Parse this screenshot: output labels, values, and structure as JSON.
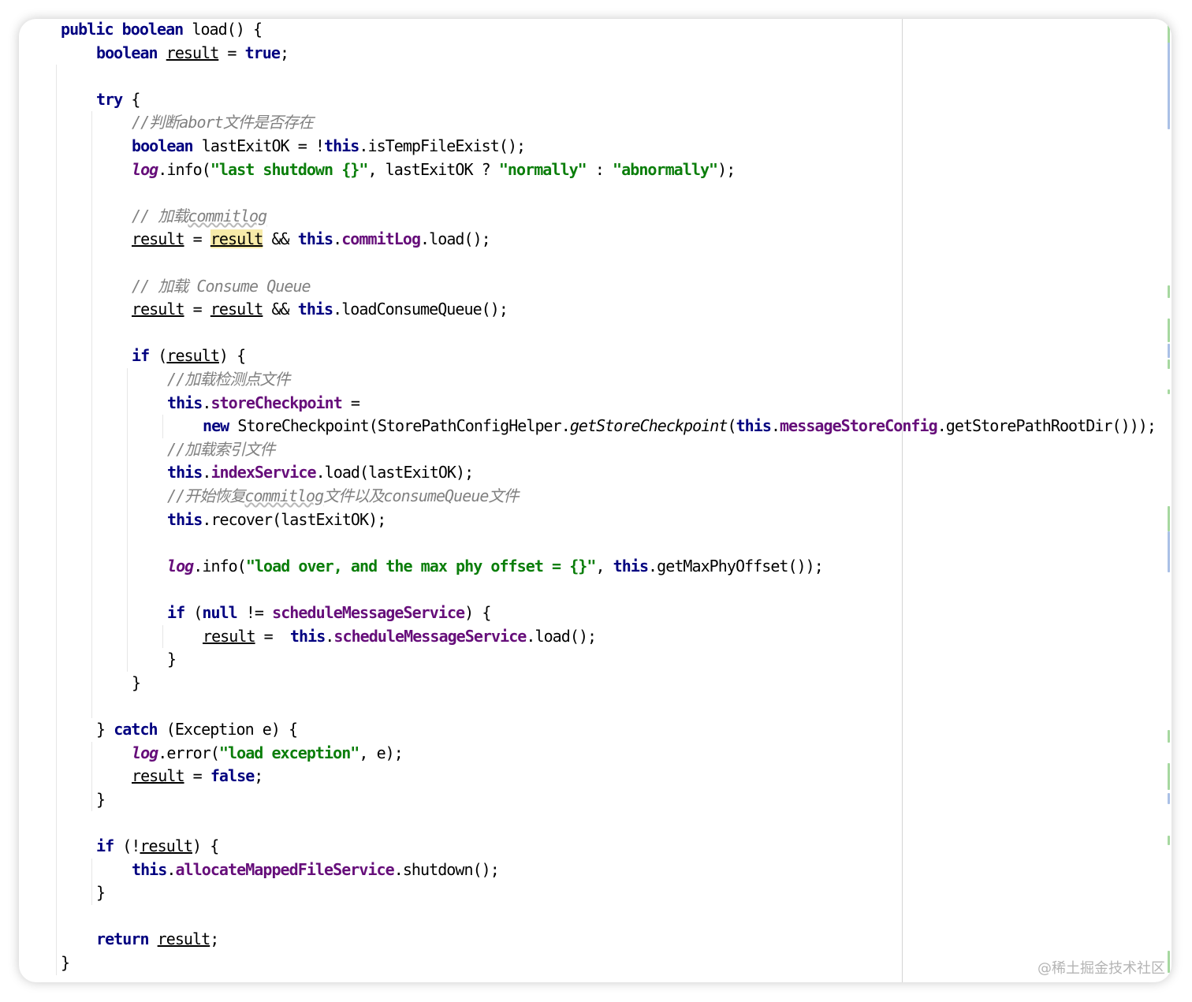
{
  "editor": {
    "language": "Java",
    "lines": [
      [
        [
          "kw",
          "public"
        ],
        [
          "t",
          " "
        ],
        [
          "kw",
          "boolean"
        ],
        [
          "t",
          " load() {"
        ]
      ],
      [
        [
          "kw",
          "boolean"
        ],
        [
          "t",
          " "
        ],
        [
          "var",
          "result"
        ],
        [
          "t",
          " = "
        ],
        [
          "kw",
          "true"
        ],
        [
          "t",
          ";"
        ]
      ],
      [],
      [
        [
          "kw",
          "try"
        ],
        [
          "t",
          " {"
        ]
      ],
      [
        [
          "cm",
          "//判断abort文件是否存在"
        ]
      ],
      [
        [
          "kw",
          "boolean"
        ],
        [
          "t",
          " lastExitOK = !"
        ],
        [
          "kw",
          "this"
        ],
        [
          "t",
          ".isTempFileExist();"
        ]
      ],
      [
        [
          "st",
          "log"
        ],
        [
          "t",
          ".info("
        ],
        [
          "str",
          "\"last shutdown {}\""
        ],
        [
          "t",
          ", lastExitOK ? "
        ],
        [
          "str",
          "\"normally\""
        ],
        [
          "t",
          " : "
        ],
        [
          "str",
          "\"abnormally\""
        ],
        [
          "t",
          ");"
        ]
      ],
      [],
      [
        [
          "cm",
          "// 加载"
        ],
        [
          "cmsq",
          "commitlog"
        ]
      ],
      [
        [
          "var",
          "result"
        ],
        [
          "t",
          " = "
        ],
        [
          "varhl",
          "result"
        ],
        [
          "t",
          " && "
        ],
        [
          "kw",
          "this"
        ],
        [
          "t",
          "."
        ],
        [
          "fld",
          "commitLog"
        ],
        [
          "t",
          ".load();"
        ]
      ],
      [],
      [
        [
          "cm",
          "// 加载 Consume Queue"
        ]
      ],
      [
        [
          "var",
          "result"
        ],
        [
          "t",
          " = "
        ],
        [
          "var",
          "result"
        ],
        [
          "t",
          " && "
        ],
        [
          "kw",
          "this"
        ],
        [
          "t",
          ".loadConsumeQueue();"
        ]
      ],
      [],
      [
        [
          "kw",
          "if"
        ],
        [
          "t",
          " ("
        ],
        [
          "var",
          "result"
        ],
        [
          "t",
          ") {"
        ]
      ],
      [
        [
          "cm",
          "//加载检测点文件"
        ]
      ],
      [
        [
          "kw",
          "this"
        ],
        [
          "t",
          "."
        ],
        [
          "fld",
          "storeCheckpoint"
        ],
        [
          "t",
          " ="
        ]
      ],
      [
        [
          "kw",
          "new"
        ],
        [
          "t",
          " StoreCheckpoint(StorePathConfigHelper."
        ],
        [
          "sm",
          "getStoreCheckpoint"
        ],
        [
          "t",
          "("
        ],
        [
          "kw",
          "this"
        ],
        [
          "t",
          "."
        ],
        [
          "fld",
          "messageStoreConfig"
        ],
        [
          "t",
          ".getStorePathRootDir()));"
        ]
      ],
      [
        [
          "cm",
          "//加载索引文件"
        ]
      ],
      [
        [
          "kw",
          "this"
        ],
        [
          "t",
          "."
        ],
        [
          "fld",
          "indexService"
        ],
        [
          "t",
          ".load(lastExitOK);"
        ]
      ],
      [
        [
          "cm",
          "//开始恢复"
        ],
        [
          "cmsq",
          "commitlog"
        ],
        [
          "cm",
          "文件以及consumeQueue文件"
        ]
      ],
      [
        [
          "kw",
          "this"
        ],
        [
          "t",
          ".recover(lastExitOK);"
        ]
      ],
      [],
      [
        [
          "st",
          "log"
        ],
        [
          "t",
          ".info("
        ],
        [
          "str",
          "\"load over, and the max phy offset = {}\""
        ],
        [
          "t",
          ", "
        ],
        [
          "kw",
          "this"
        ],
        [
          "t",
          ".getMaxPhyOffset());"
        ]
      ],
      [],
      [
        [
          "kw",
          "if"
        ],
        [
          "t",
          " ("
        ],
        [
          "kw",
          "null"
        ],
        [
          "t",
          " != "
        ],
        [
          "fld",
          "scheduleMessageService"
        ],
        [
          "t",
          ") {"
        ]
      ],
      [
        [
          "var",
          "result"
        ],
        [
          "t",
          " =  "
        ],
        [
          "kw",
          "this"
        ],
        [
          "t",
          "."
        ],
        [
          "fld",
          "scheduleMessageService"
        ],
        [
          "t",
          ".load();"
        ]
      ],
      [
        [
          "t",
          "}"
        ]
      ],
      [
        [
          "t",
          "}"
        ]
      ],
      [],
      [
        [
          "t",
          "} "
        ],
        [
          "kw",
          "catch"
        ],
        [
          "t",
          " (Exception e) {"
        ]
      ],
      [
        [
          "st",
          "log"
        ],
        [
          "t",
          ".error("
        ],
        [
          "str",
          "\"load exception\""
        ],
        [
          "t",
          ", e);"
        ]
      ],
      [
        [
          "var",
          "result"
        ],
        [
          "t",
          " = "
        ],
        [
          "kw",
          "false"
        ],
        [
          "t",
          ";"
        ]
      ],
      [
        [
          "t",
          "}"
        ]
      ],
      [],
      [
        [
          "kw",
          "if"
        ],
        [
          "t",
          " (!"
        ],
        [
          "var",
          "result"
        ],
        [
          "t",
          ") {"
        ]
      ],
      [
        [
          "kw",
          "this"
        ],
        [
          "t",
          "."
        ],
        [
          "fld",
          "allocateMappedFileService"
        ],
        [
          "t",
          ".shutdown();"
        ]
      ],
      [
        [
          "t",
          "}"
        ]
      ],
      [],
      [
        [
          "kw",
          "return"
        ],
        [
          "t",
          " "
        ],
        [
          "var",
          "result"
        ],
        [
          "t",
          ";"
        ]
      ],
      [
        [
          "t",
          "}"
        ]
      ]
    ]
  },
  "watermark": "@稀土掘金技术社区"
}
